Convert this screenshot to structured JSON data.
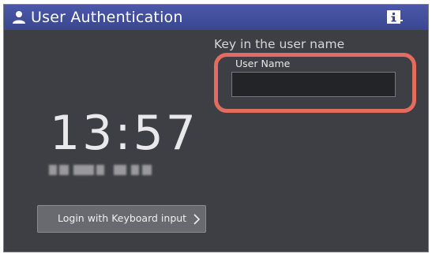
{
  "window": {
    "title": "User Authentication",
    "user_icon": "user-icon",
    "info_icon": "info-icon"
  },
  "auth": {
    "prompt": "Key in the user name",
    "field_label": "User Name",
    "field_value": ""
  },
  "clock": {
    "time": "13:57",
    "date_obscured": true
  },
  "actions": {
    "keyboard_login_label": "Login with Keyboard input",
    "chevron_icon": "chevron-right-icon"
  },
  "colors": {
    "titlebar": "#3a4691",
    "panel": "#3e3f44",
    "highlight": "#e36c5f",
    "button": "#696a6f"
  }
}
